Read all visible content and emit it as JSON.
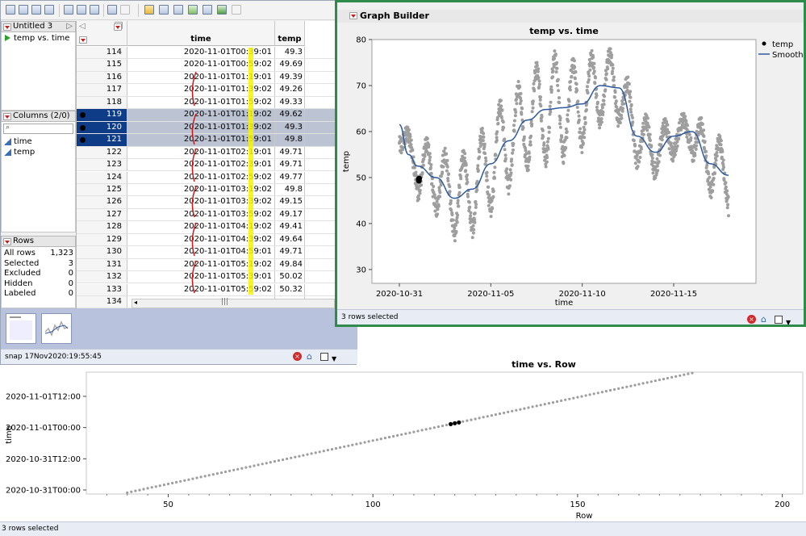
{
  "table_window": {
    "title": "Untitled 3",
    "script_item": "temp vs. time",
    "columns_header": "Columns (2/0)",
    "columns": [
      "time",
      "temp"
    ],
    "rows_header": "Rows",
    "row_stats": [
      {
        "label": "All rows",
        "value": "1,323"
      },
      {
        "label": "Selected",
        "value": "3"
      },
      {
        "label": "Excluded",
        "value": "0"
      },
      {
        "label": "Hidden",
        "value": "0"
      },
      {
        "label": "Labeled",
        "value": "0"
      }
    ],
    "col_headers": {
      "time": "time",
      "temp": "temp"
    },
    "rows": [
      {
        "n": "114",
        "time": "2020-11-01T00:39:01",
        "temp": "49.3",
        "sel": false
      },
      {
        "n": "115",
        "time": "2020-11-01T00:59:02",
        "temp": "49.69",
        "sel": false
      },
      {
        "n": "116",
        "time": "2020-11-01T01:19:01",
        "temp": "49.39",
        "sel": false
      },
      {
        "n": "117",
        "time": "2020-11-01T01:39:02",
        "temp": "49.26",
        "sel": false
      },
      {
        "n": "118",
        "time": "2020-11-01T01:59:02",
        "temp": "49.33",
        "sel": false
      },
      {
        "n": "119",
        "time": "2020-11-01T01:19:02",
        "temp": "49.62",
        "sel": true
      },
      {
        "n": "120",
        "time": "2020-11-01T01:39:02",
        "temp": "49.3",
        "sel": true
      },
      {
        "n": "121",
        "time": "2020-11-01T01:59:01",
        "temp": "49.8",
        "sel": true
      },
      {
        "n": "122",
        "time": "2020-11-01T02:19:01",
        "temp": "49.71",
        "sel": false
      },
      {
        "n": "123",
        "time": "2020-11-01T02:39:01",
        "temp": "49.71",
        "sel": false
      },
      {
        "n": "124",
        "time": "2020-11-01T02:59:02",
        "temp": "49.77",
        "sel": false
      },
      {
        "n": "125",
        "time": "2020-11-01T03:19:02",
        "temp": "49.8",
        "sel": false
      },
      {
        "n": "126",
        "time": "2020-11-01T03:39:02",
        "temp": "49.15",
        "sel": false
      },
      {
        "n": "127",
        "time": "2020-11-01T03:59:02",
        "temp": "49.17",
        "sel": false
      },
      {
        "n": "128",
        "time": "2020-11-01T04:19:02",
        "temp": "49.41",
        "sel": false
      },
      {
        "n": "129",
        "time": "2020-11-01T04:39:02",
        "temp": "49.64",
        "sel": false
      },
      {
        "n": "130",
        "time": "2020-11-01T04:59:01",
        "temp": "49.71",
        "sel": false
      },
      {
        "n": "131",
        "time": "2020-11-01T05:19:02",
        "temp": "49.84",
        "sel": false
      },
      {
        "n": "132",
        "time": "2020-11-01T05:39:01",
        "temp": "50.02",
        "sel": false
      },
      {
        "n": "133",
        "time": "2020-11-01T05:59:02",
        "temp": "50.32",
        "sel": false
      },
      {
        "n": "134",
        "time": "",
        "temp": "",
        "sel": false
      }
    ],
    "status": "snap 17Nov2020:19:55:45"
  },
  "graph_builder": {
    "title": "Graph Builder",
    "status": "3 rows selected"
  },
  "bottom_window": {
    "status": "3 rows selected"
  },
  "colors": {
    "points": "#9e9e9e",
    "smooth": "#2e5a9e",
    "selected": "#000000",
    "gb_border": "#2e8b4a"
  },
  "chart_data": [
    {
      "type": "scatter",
      "title": "temp vs. time",
      "xlabel": "time",
      "ylabel": "temp",
      "xlim": [
        "2020-10-29T12:00",
        "2020-11-19T12:00"
      ],
      "ylim": [
        27,
        80
      ],
      "xticks": [
        "2020-10-31",
        "2020-11-05",
        "2020-11-10",
        "2020-11-15"
      ],
      "yticks": [
        30,
        40,
        50,
        60,
        70,
        80
      ],
      "legend": {
        "placement": "right",
        "entries": [
          "temp",
          "Smooth"
        ]
      },
      "series": [
        {
          "name": "Smooth",
          "x": [
            "2020-10-31T00:00",
            "2020-10-31T12:00",
            "2020-11-01T00:00",
            "2020-11-02T00:00",
            "2020-11-03T00:00",
            "2020-11-04T00:00",
            "2020-11-05T00:00",
            "2020-11-06T00:00",
            "2020-11-07T00:00",
            "2020-11-08T00:00",
            "2020-11-09T00:00",
            "2020-11-10T00:00",
            "2020-11-11T00:00",
            "2020-11-12T00:00",
            "2020-11-13T00:00",
            "2020-11-14T00:00",
            "2020-11-15T00:00",
            "2020-11-16T00:00",
            "2020-11-17T00:00",
            "2020-11-18T00:00"
          ],
          "y": [
            61.5,
            55,
            52.5,
            50,
            45.5,
            47.5,
            53,
            58,
            62.5,
            64.8,
            65.2,
            66,
            70,
            69.5,
            59,
            55.5,
            59,
            60,
            53,
            50.5
          ]
        }
      ]
    },
    {
      "type": "scatter",
      "title": "time vs. Row",
      "xlabel": "Row",
      "ylabel": "time",
      "xlim": [
        30,
        205
      ],
      "xticks": [
        50,
        100,
        150,
        200
      ],
      "yticks": [
        "2020-10-31T00:00",
        "2020-10-31T12:00",
        "2020-11-01T00:00",
        "2020-11-01T12:00"
      ],
      "selected_rows": [
        119,
        120,
        121
      ]
    }
  ]
}
